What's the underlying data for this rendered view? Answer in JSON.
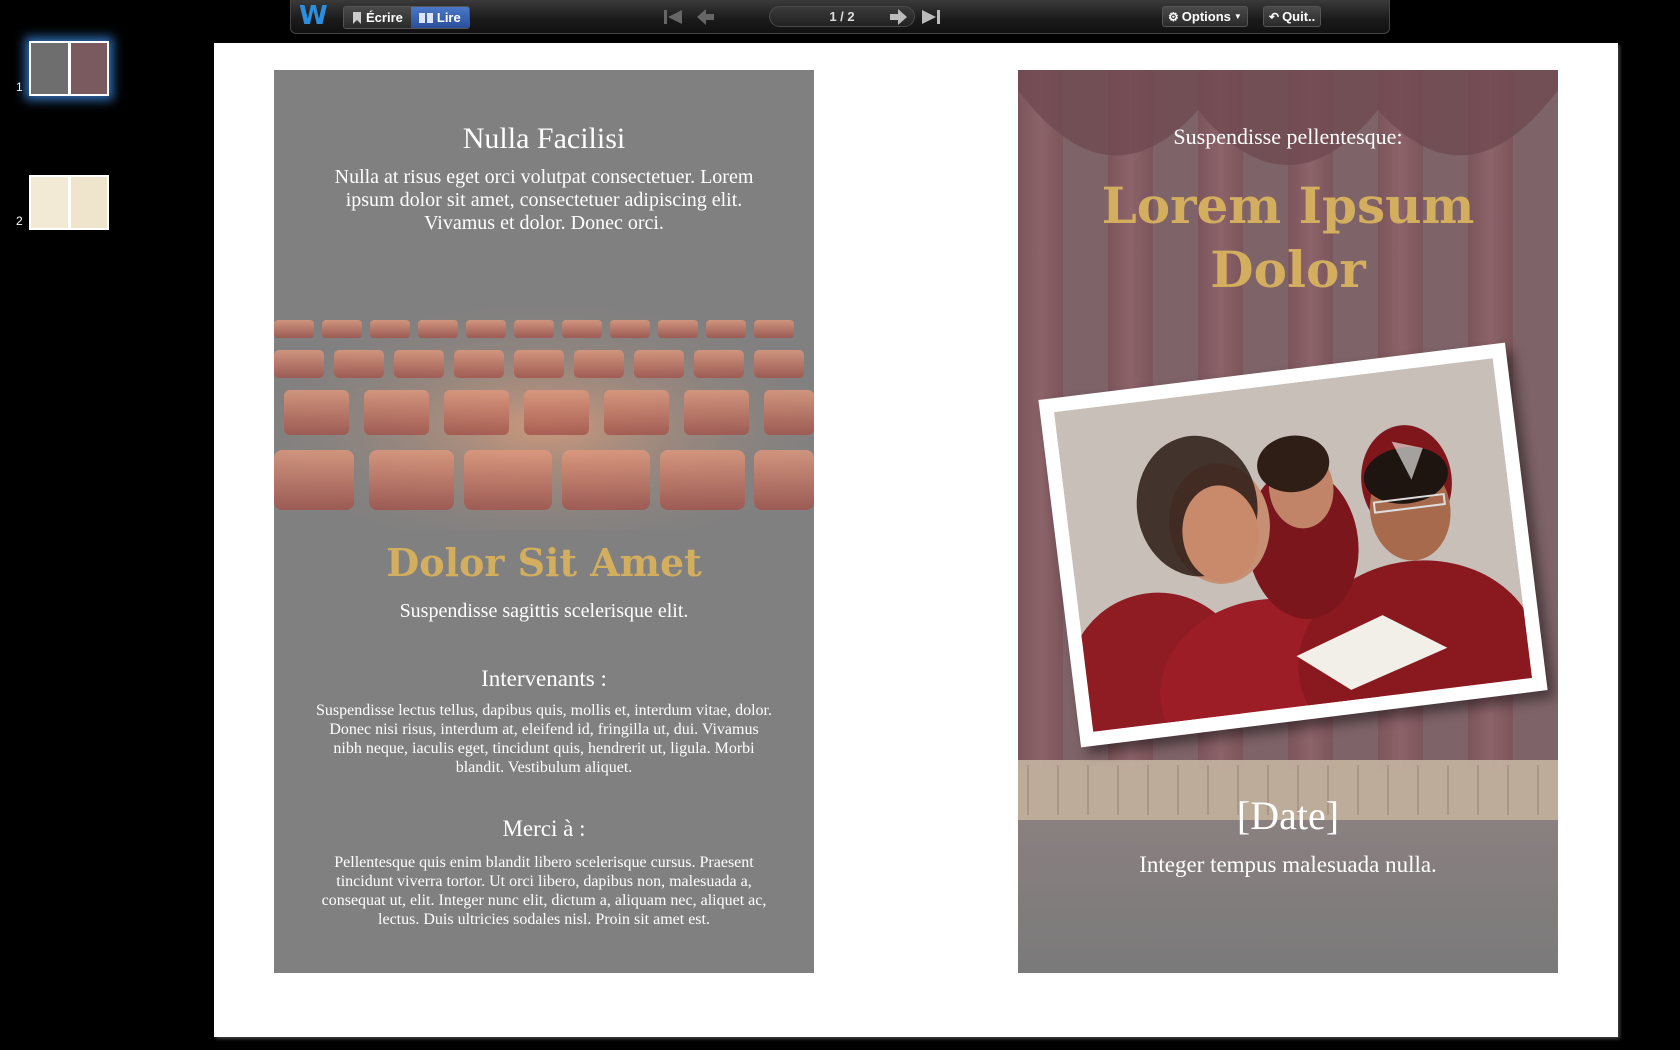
{
  "toolbar": {
    "write_label": "Écrire",
    "read_label": "Lire",
    "page_indicator": "1 / 2",
    "options_label": "Options",
    "quit_label": "Quit.."
  },
  "thumbnails": [
    {
      "number": "1",
      "selected": true
    },
    {
      "number": "2",
      "selected": false
    }
  ],
  "left_panel": {
    "title": "Nulla Facilisi",
    "intro": "Nulla at risus eget orci volutpat consectetuer. Lorem ipsum dolor sit amet, consectetuer adipiscing elit. Vivamus et dolor. Donec orci.",
    "headline": "Dolor Sit Amet",
    "subline": "Suspendisse sagittis scelerisque elit.",
    "speakers_heading": "Intervenants :",
    "speakers_text": "Suspendisse lectus tellus, dapibus quis, mollis et, interdum vitae, dolor. Donec nisi risus, interdum at, eleifend id, fringilla ut, dui. Vivamus nibh neque, iaculis eget, tincidunt quis, hendrerit ut, ligula. Morbi blandit. Vestibulum aliquet.",
    "thanks_heading": "Merci à :",
    "thanks_text": "Pellentesque quis enim blandit libero scelerisque cursus. Praesent tincidunt viverra tortor. Ut orci libero, dapibus non, malesuada a, consequat ut, elit. Integer nunc elit, dictum a, aliquam nec, aliquet ac, lectus. Duis ultricies sodales nisl. Proin sit amet est."
  },
  "right_panel": {
    "kicker": "Suspendisse pellentesque:",
    "title_line1": "Lorem Ipsum",
    "title_line2": "Dolor",
    "date": "[Date]",
    "tagline": "Integer tempus malesuada nulla."
  },
  "colors": {
    "accent_gold": "#d2ae5e",
    "panel_gray": "#808080",
    "toolbar_blue": "#2a4f9c"
  }
}
